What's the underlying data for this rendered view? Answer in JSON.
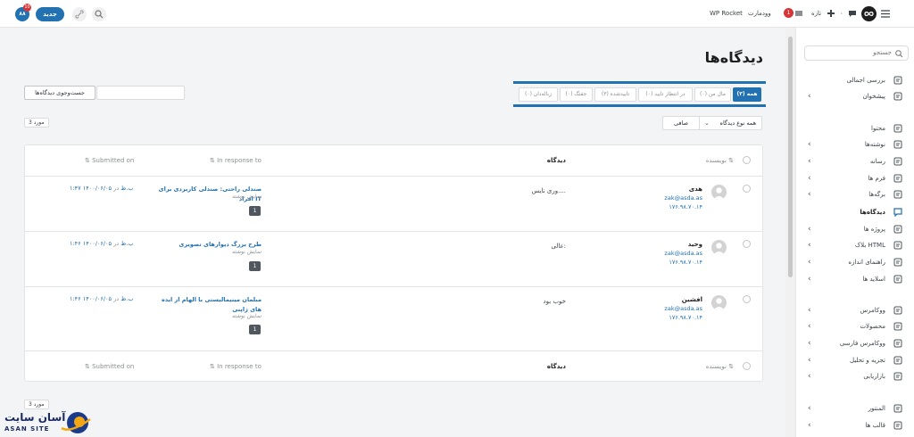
{
  "topbar": {
    "wp_rocket": "WP Rocket",
    "site_name": "وودمارت",
    "new_label": "تازه",
    "comment_count": "۰",
    "update_count": "1",
    "new_button": "جدید",
    "notif_badge_value": "۸۸",
    "notif_count": "10"
  },
  "sidebar": {
    "search_placeholder": "جستجو",
    "items": [
      {
        "label": "بررسی اجمالی",
        "icon": "dashboard-icon",
        "chevron": false
      },
      {
        "label": "پیشخوان",
        "icon": "dashboard-grid-icon",
        "chevron": true
      },
      {
        "label": "محتوا",
        "icon": "content-icon",
        "chevron": false
      },
      {
        "label": "نوشته‌ها",
        "icon": "posts-icon",
        "chevron": true
      },
      {
        "label": "رسانه",
        "icon": "media-icon",
        "chevron": true
      },
      {
        "label": "فرم ها",
        "icon": "forms-icon",
        "chevron": true
      },
      {
        "label": "برگه‌ها",
        "icon": "pages-icon",
        "chevron": true
      },
      {
        "label": "دیدگاه‌ها",
        "icon": "comments-icon",
        "chevron": false,
        "active": true
      },
      {
        "label": "پروژه ها",
        "icon": "projects-icon",
        "chevron": true
      },
      {
        "label": "بلاک HTML",
        "icon": "html-block-icon",
        "chevron": true
      },
      {
        "label": "راهنمای اندازه",
        "icon": "size-guide-icon",
        "chevron": true
      },
      {
        "label": "اسلاید ها",
        "icon": "slides-icon",
        "chevron": true
      },
      {
        "label": "ووکامرس",
        "icon": "woocommerce-icon",
        "chevron": true
      },
      {
        "label": "محصولات",
        "icon": "products-icon",
        "chevron": true
      },
      {
        "label": "ووکامرس فارسی",
        "icon": "woocommerce-fa-icon",
        "chevron": true
      },
      {
        "label": "تجزیه و تحلیل",
        "icon": "analytics-icon",
        "chevron": true
      },
      {
        "label": "بازاریابی",
        "icon": "marketing-icon",
        "chevron": true
      },
      {
        "label": "المنتور",
        "icon": "elementor-icon",
        "chevron": true
      },
      {
        "label": "قالب ها",
        "icon": "templates-icon",
        "chevron": true
      }
    ]
  },
  "main": {
    "title": "دیدگاه‌ها",
    "tabs": [
      {
        "label": "همه (۳)",
        "active": true
      },
      {
        "label": "مال من (۰)"
      },
      {
        "label": "در انتظار تایید (۰)"
      },
      {
        "label": "تاییدشده (۳)"
      },
      {
        "label": "جفنگ (۰)"
      },
      {
        "label": "زباله‌دان (۰)"
      }
    ],
    "search_button": "جست‌وجوی دیدگاه‌ها",
    "search_value": "",
    "filter_type": "همه نوع دیدگاه",
    "filter_button": "صافی",
    "count_top": "3 مورد",
    "count_bottom": "3 مورد"
  },
  "table": {
    "headers": {
      "author": "نویسنده",
      "comment": "دیدگاه",
      "in_response_to": "In response to",
      "submitted_on": "Submitted on"
    },
    "rows": [
      {
        "author": "هدی",
        "email": "zak@asda.as",
        "ip": "۱۷۶.۹۸.۷۰.۱۴",
        "comment": "وری نایس....",
        "post": "صندلی راحتی: صندلی کاربردی برای افراد IT",
        "view": "نمایش نوشته",
        "bubble": "1",
        "date": "۱۴۰۰/۰۶/۰۵",
        "at": "در",
        "time": "۱:۴۷ ب.ظ"
      },
      {
        "author": "وحید",
        "email": "zak@asda.as",
        "ip": "۱۷۶.۹۸.۷۰.۱۴",
        "comment": "عالی:",
        "post": "طرح بزرگ دیوارهای تصویری",
        "view": "نمایش نوشته",
        "bubble": "1",
        "date": "۱۴۰۰/۰۶/۰۵",
        "at": "در",
        "time": "۱:۴۶ ب.ظ"
      },
      {
        "author": "افشین",
        "email": "zak@asda.as",
        "ip": "۱۷۶.۹۸.۷۰.۱۴",
        "comment": "خوب بود",
        "post": "مبلمان مینیمالیستی با الهام از ایده های ژاپنی",
        "view": "نمایش نوشته",
        "bubble": "1",
        "date": "۱۴۰۰/۰۶/۰۵",
        "at": "در",
        "time": "۱:۴۶ ب.ظ"
      }
    ]
  },
  "logo": {
    "name_fa": "آسان سایت",
    "name_en": "ASAN SITE"
  },
  "colors": {
    "accent": "#2271b1",
    "badge": "#d63638"
  }
}
